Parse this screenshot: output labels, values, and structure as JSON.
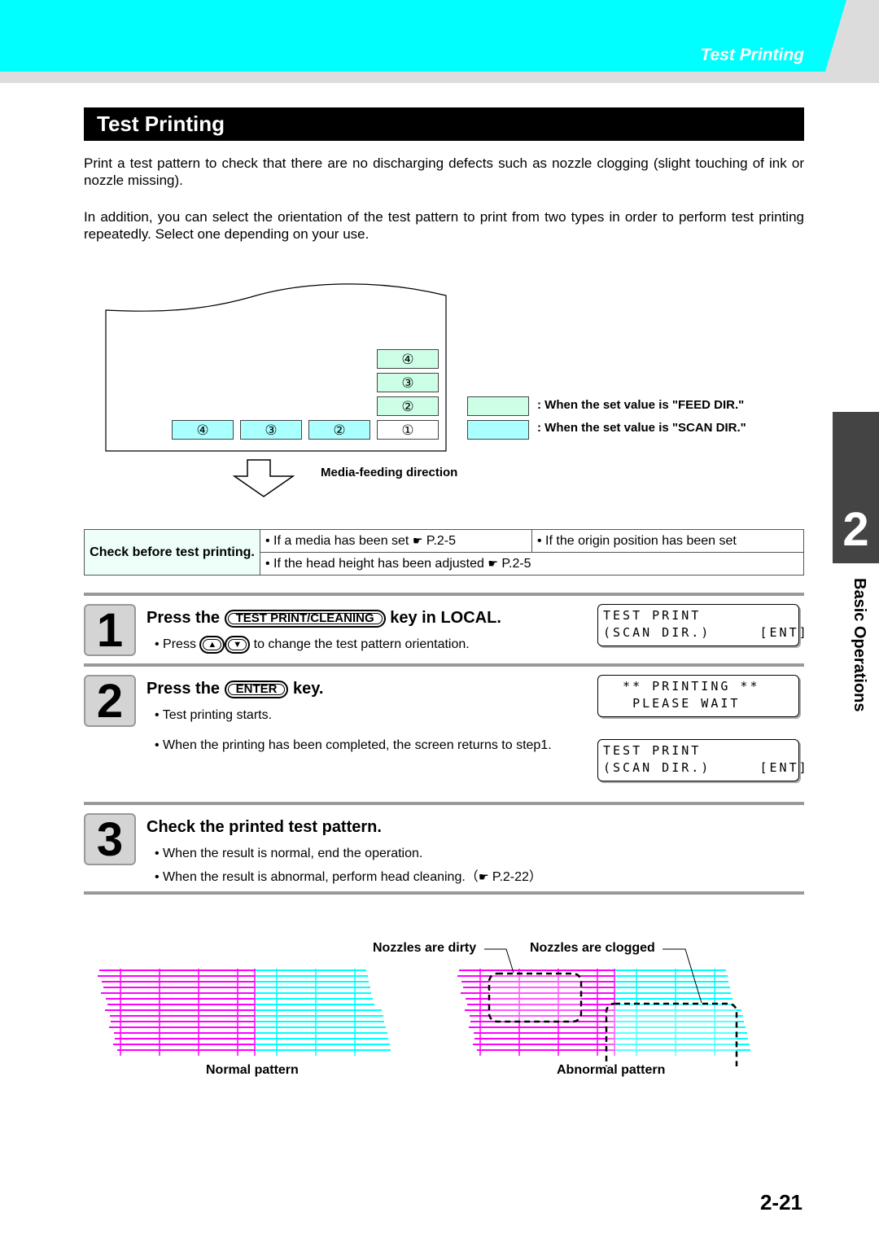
{
  "header": {
    "section_title": "Test Printing"
  },
  "title": "Test Printing",
  "intro": [
    "Print a test pattern to check that there are no discharging defects such as nozzle clogging (slight touching of ink or nozzle missing).",
    "In addition, you can select the orientation of the test pattern to print from two types in order to perform test printing repeatedly. Select one depending on your use."
  ],
  "diagram": {
    "feed_boxes": [
      "④",
      "③",
      "②"
    ],
    "origin_box": "①",
    "scan_boxes": [
      "④",
      "③",
      "②"
    ],
    "legend_feed": ": When the set value is \"FEED DIR.\"",
    "legend_scan": ": When the set value is \"SCAN DIR.\"",
    "direction_label": "Media-feeding direction",
    "colors": {
      "feed": "#ccffe6",
      "scan": "#aaffff"
    }
  },
  "check": {
    "label": "Check before test printing.",
    "items": [
      "If a media has been set",
      "If the origin position has been set",
      "If the head height has been adjusted"
    ],
    "refs": [
      "P.2-5",
      "P.2-5"
    ]
  },
  "steps": [
    {
      "number": "1",
      "pre": "Press the",
      "key": "TEST PRINT/CLEANING",
      "post": "key in LOCAL.",
      "bullet_pre": "• Press",
      "keys": [
        "▲",
        "▼"
      ],
      "bullet_post": "to change the test pattern orientation.",
      "lcd": [
        "TEST PRINT",
        "(SCAN DIR.)     [ENT]"
      ]
    },
    {
      "number": "2",
      "pre": "Press the",
      "key": "ENTER",
      "post": "key.",
      "bullets": [
        "• Test printing starts.",
        "• When the printing has been completed, the screen returns to step1."
      ],
      "lcd1": [
        "  ** PRINTING **",
        "   PLEASE WAIT"
      ],
      "lcd2": [
        "TEST PRINT",
        "(SCAN DIR.)     [ENT]"
      ]
    },
    {
      "number": "3",
      "heading": "Check the printed test pattern.",
      "bullets": [
        "• When the result is normal, end the operation.",
        "• When the result is abnormal, perform head cleaning."
      ],
      "ref": "P.2-22"
    }
  ],
  "patterns": {
    "dirty": "Nozzles are dirty",
    "clogged": "Nozzles are clogged",
    "normal": "Normal pattern",
    "abnormal": "Abnormal pattern",
    "colors": {
      "magenta": "#ff00ff",
      "cyan": "#00ffff"
    }
  },
  "side": {
    "chapter": "2",
    "label": "Basic Operations"
  },
  "page_number": "2-21"
}
